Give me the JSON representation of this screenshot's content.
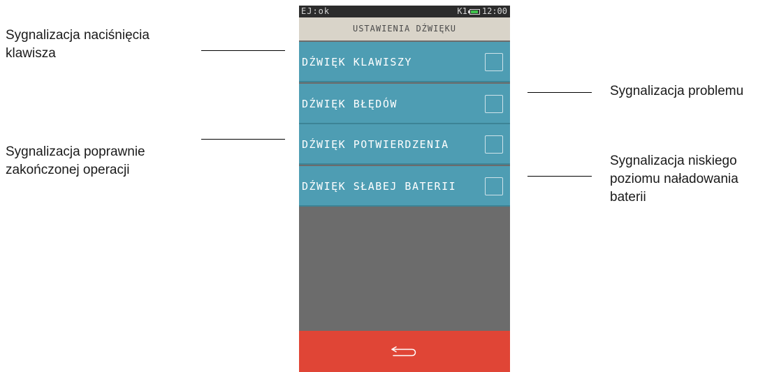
{
  "annotations": {
    "key_sound": "Sygnalizacja naciśnięcia\nklawisza",
    "error_sound": "Sygnalizacja problemu",
    "confirm_sound": "Sygnalizacja poprawnie\nzakończonej operacji",
    "low_battery": "Sygnalizacja niskiego\npoziomu naładowania\nbaterii"
  },
  "device": {
    "status": {
      "left": "EJ:ok",
      "register": "K1",
      "time": "12:00",
      "battery_icon": "battery-icon"
    },
    "title": "USTAWIENIA DŹWIĘKU",
    "items": [
      {
        "label": "DŹWIĘK KLAWISZY",
        "checked": false
      },
      {
        "label": "DŹWIĘK BŁĘDÓW",
        "checked": false
      },
      {
        "label": "DŹWIĘK POTWIERDZENIA",
        "checked": false
      },
      {
        "label": "DŹWIĘK SŁABEJ BATERII",
        "checked": false
      }
    ],
    "back_icon": "back-arrow-icon"
  },
  "colors": {
    "item_bg": "#4e9db3",
    "title_bg": "#d9d4c9",
    "back_bg": "#e04536",
    "screen_bg": "#6c6c6c",
    "status_bg": "#2c2c2c"
  }
}
